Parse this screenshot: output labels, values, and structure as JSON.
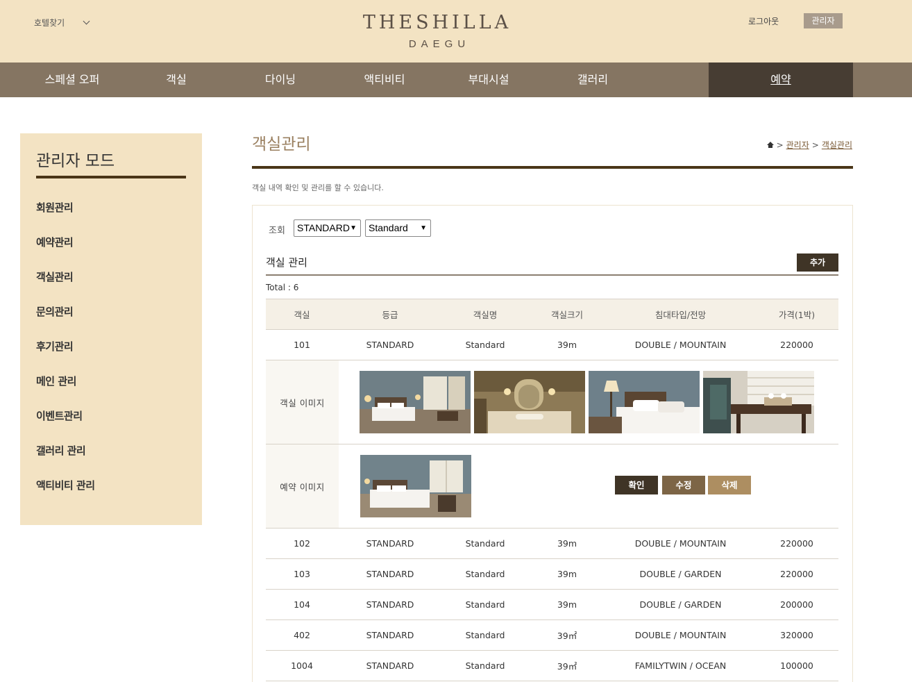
{
  "header": {
    "hotel_select_label": "호텔찾기",
    "logo_main": "THESHILLA",
    "logo_sub": "DAEGU",
    "logout_label": "로그아웃",
    "admin_label": "관리자"
  },
  "nav": {
    "items": [
      {
        "label": "스페셜 오퍼"
      },
      {
        "label": "객실"
      },
      {
        "label": "다이닝"
      },
      {
        "label": "액티비티"
      },
      {
        "label": "부대시설"
      },
      {
        "label": "갤러리"
      },
      {
        "label": "예약"
      }
    ],
    "active_index": 6
  },
  "sidebar": {
    "title": "관리자 모드",
    "items": [
      {
        "label": "회원관리"
      },
      {
        "label": "예약관리"
      },
      {
        "label": "객실관리"
      },
      {
        "label": "문의관리"
      },
      {
        "label": "후기관리"
      },
      {
        "label": "메인 관리"
      },
      {
        "label": "이벤트관리"
      },
      {
        "label": "갤러리 관리"
      },
      {
        "label": "액티비티 관리"
      }
    ]
  },
  "main": {
    "title": "객실관리",
    "breadcrumb": [
      "관리자",
      "객실관리"
    ],
    "description": "객실 내역 확인 및 관리를 할 수 있습니다.",
    "filter": {
      "label": "조회",
      "grade_value": "STANDARD",
      "name_value": "Standard"
    },
    "section_title": "객실 관리",
    "add_label": "추가",
    "total": "Total : 6"
  },
  "table": {
    "headers": [
      "객실",
      "등급",
      "객실명",
      "객실크기",
      "침대타입/전망",
      "가격(1박)"
    ],
    "rows": [
      [
        "101",
        "STANDARD",
        "Standard",
        "39m",
        "DOUBLE / MOUNTAIN",
        "220000"
      ],
      [
        "102",
        "STANDARD",
        "Standard",
        "39m",
        "DOUBLE / MOUNTAIN",
        "220000"
      ],
      [
        "103",
        "STANDARD",
        "Standard",
        "39m",
        "DOUBLE / GARDEN",
        "220000"
      ],
      [
        "104",
        "STANDARD",
        "Standard",
        "39m",
        "DOUBLE / GARDEN",
        "200000"
      ],
      [
        "402",
        "STANDARD",
        "Standard",
        "39㎡",
        "DOUBLE / MOUNTAIN",
        "320000"
      ],
      [
        "1004",
        "STANDARD",
        "Standard",
        "39㎡",
        "FAMILYTWIN / OCEAN",
        "100000"
      ]
    ],
    "room_image_label": "객실 이미지",
    "booking_image_label": "예약 이미지",
    "actions": {
      "confirm": "확인",
      "edit": "수정",
      "delete": "삭제"
    }
  },
  "colors": {
    "header_bg": "#f3e3c3",
    "nav_bg": "#857562",
    "nav_active_bg": "#473d33",
    "accent_dark": "#4a3618",
    "confirm_btn": "#3f3426",
    "edit_btn": "#7d6546",
    "delete_btn": "#ad8e61"
  }
}
